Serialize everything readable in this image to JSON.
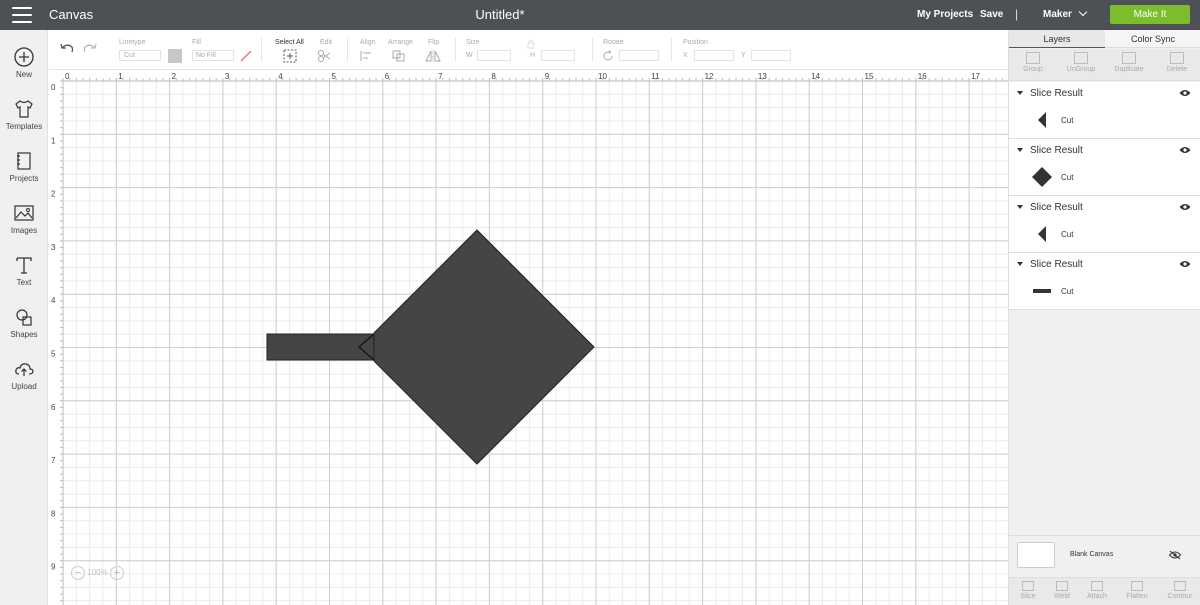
{
  "header": {
    "app_title": "Canvas",
    "doc_title": "Untitled*",
    "my_projects": "My Projects",
    "save": "Save",
    "separator": "|",
    "machine": "Maker",
    "make_it": "Make It"
  },
  "sidebar": {
    "items": [
      {
        "label": "New",
        "icon": "plus-circle-icon"
      },
      {
        "label": "Templates",
        "icon": "tshirt-icon"
      },
      {
        "label": "Projects",
        "icon": "notebook-icon"
      },
      {
        "label": "Images",
        "icon": "image-icon"
      },
      {
        "label": "Text",
        "icon": "text-t-icon"
      },
      {
        "label": "Shapes",
        "icon": "shapes-icon"
      },
      {
        "label": "Upload",
        "icon": "cloud-upload-icon"
      }
    ]
  },
  "toolbar": {
    "linetype_label": "Linetype",
    "linetype_value": "Cut",
    "fill_label": "Fill",
    "fill_value": "No Fill",
    "select_all": "Select All",
    "edit": "Edit",
    "align": "Align",
    "arrange": "Arrange",
    "flip": "Flip",
    "size": "Size",
    "w": "W",
    "h": "H",
    "rotate": "Rotate",
    "position": "Position",
    "x": "X",
    "y": "Y"
  },
  "ruler": {
    "x_ticks": [
      "0",
      "1",
      "2",
      "3",
      "4",
      "5",
      "6",
      "7",
      "8",
      "9",
      "10",
      "11",
      "12",
      "13",
      "14",
      "15",
      "16",
      "17"
    ],
    "y_ticks": [
      "0",
      "1",
      "2",
      "3",
      "4",
      "5",
      "6",
      "7",
      "8",
      "9"
    ]
  },
  "canvas": {
    "zoom": "100%",
    "shape_color": "#454545"
  },
  "panel": {
    "tabs": [
      "Layers",
      "Color Sync"
    ],
    "actions": [
      "Group",
      "UnGroup",
      "Duplicate",
      "Delete"
    ],
    "layers": [
      {
        "title": "Slice Result",
        "sub": "Cut",
        "thumb": "left-triangle"
      },
      {
        "title": "Slice Result",
        "sub": "Cut",
        "thumb": "diamond"
      },
      {
        "title": "Slice Result",
        "sub": "Cut",
        "thumb": "left-triangle"
      },
      {
        "title": "Slice Result",
        "sub": "Cut",
        "thumb": "bar"
      }
    ],
    "blank_canvas": "Blank Canvas",
    "bottom_actions": [
      "Slice",
      "Weld",
      "Attach",
      "Flatten",
      "Contour"
    ]
  },
  "colors": {
    "header_bg": "#4d5156",
    "make_it": "#7cbd2d",
    "shape": "#454545"
  }
}
